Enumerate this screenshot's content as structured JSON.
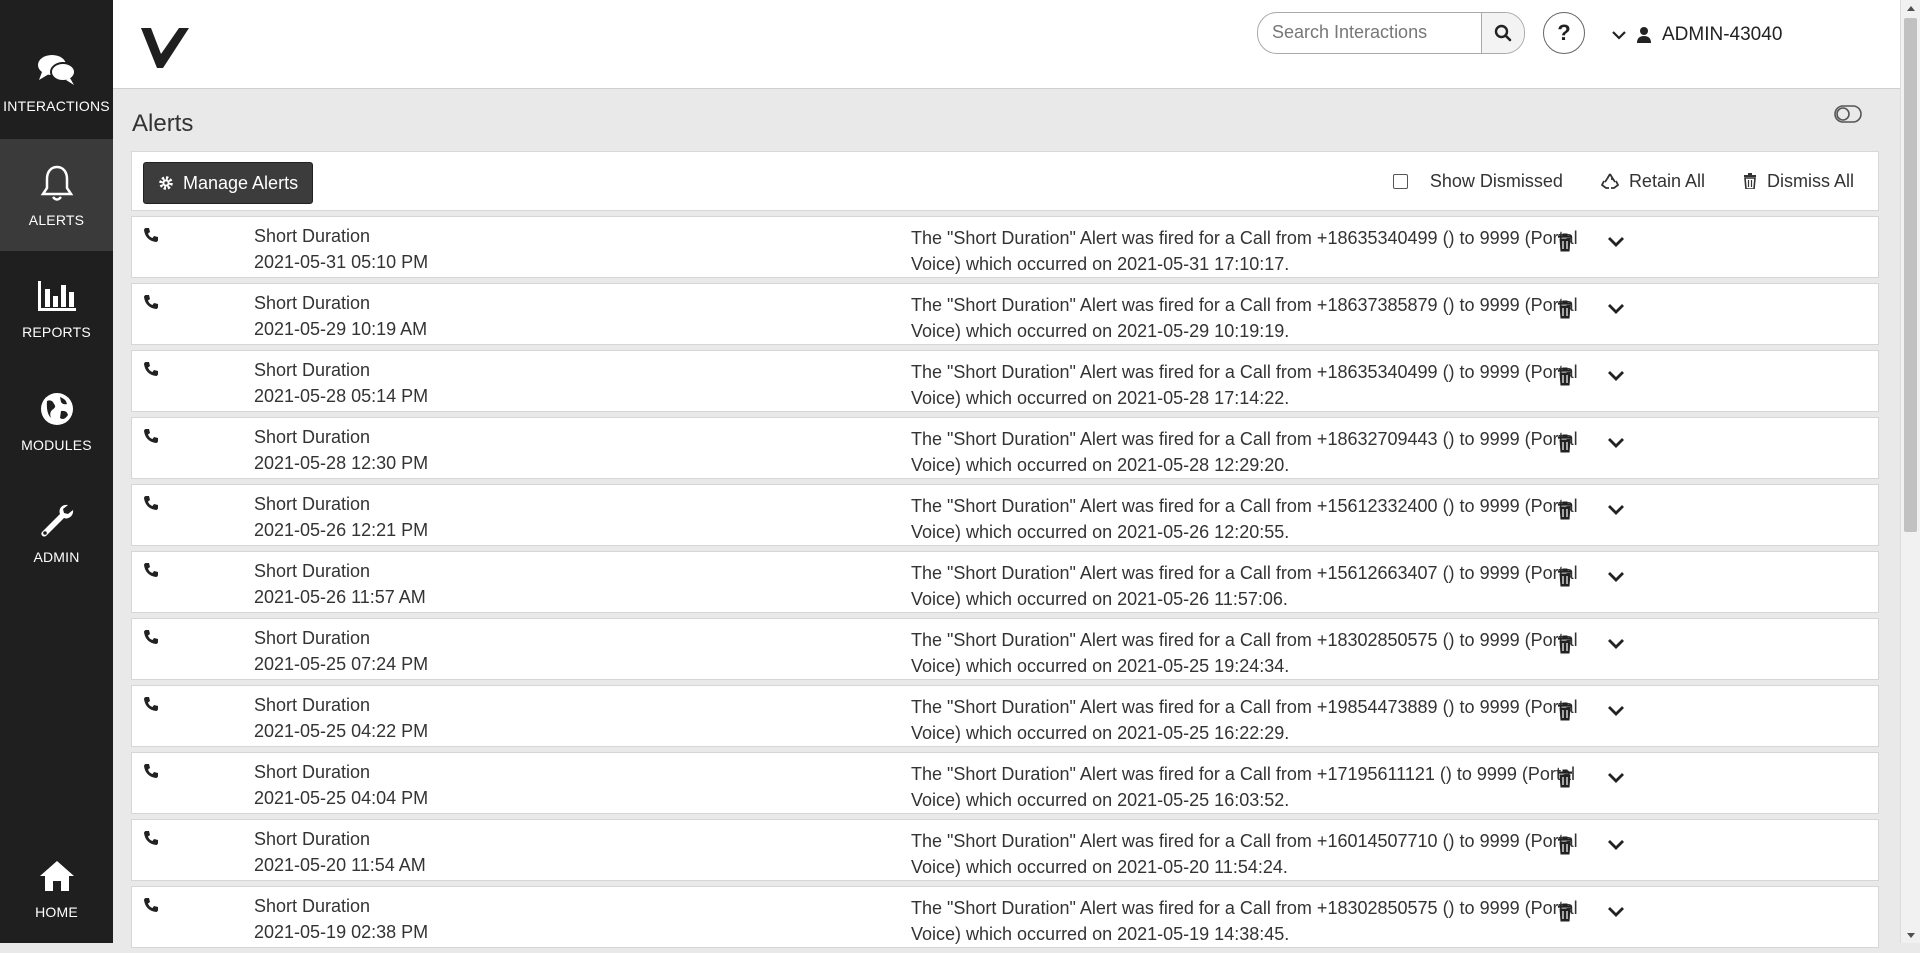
{
  "sidebar": {
    "items": [
      {
        "label": "INTERACTIONS",
        "icon": "chat-bubbles-icon"
      },
      {
        "label": "ALERTS",
        "icon": "bell-icon"
      },
      {
        "label": "REPORTS",
        "icon": "bar-chart-icon"
      },
      {
        "label": "MODULES",
        "icon": "globe-icon"
      },
      {
        "label": "ADMIN",
        "icon": "wrench-icon"
      },
      {
        "label": "HOME",
        "icon": "home-icon"
      }
    ]
  },
  "header": {
    "search_placeholder": "Search Interactions",
    "help_label": "?",
    "username": "ADMIN-43040"
  },
  "page": {
    "title": "Alerts"
  },
  "toolbar": {
    "manage_label": "Manage Alerts",
    "show_dismissed_label": "Show Dismissed",
    "retain_all_label": "Retain All",
    "dismiss_all_label": "Dismiss All"
  },
  "alerts": [
    {
      "name": "Short Duration",
      "date": "2021-05-31 05:10 PM",
      "desc": "The \"Short Duration\" Alert was fired for a Call from +18635340499 () to 9999 (Portal Voice) which occurred on 2021-05-31 17:10:17."
    },
    {
      "name": "Short Duration",
      "date": "2021-05-29 10:19 AM",
      "desc": "The \"Short Duration\" Alert was fired for a Call from +18637385879 () to 9999 (Portal Voice) which occurred on 2021-05-29 10:19:19."
    },
    {
      "name": "Short Duration",
      "date": "2021-05-28 05:14 PM",
      "desc": "The \"Short Duration\" Alert was fired for a Call from +18635340499 () to 9999 (Portal Voice) which occurred on 2021-05-28 17:14:22."
    },
    {
      "name": "Short Duration",
      "date": "2021-05-28 12:30 PM",
      "desc": "The \"Short Duration\" Alert was fired for a Call from +18632709443 () to 9999 (Portal Voice) which occurred on 2021-05-28 12:29:20."
    },
    {
      "name": "Short Duration",
      "date": "2021-05-26 12:21 PM",
      "desc": "The \"Short Duration\" Alert was fired for a Call from +15612332400 () to 9999 (Portal Voice) which occurred on 2021-05-26 12:20:55."
    },
    {
      "name": "Short Duration",
      "date": "2021-05-26 11:57 AM",
      "desc": "The \"Short Duration\" Alert was fired for a Call from +15612663407 () to 9999 (Portal Voice) which occurred on 2021-05-26 11:57:06."
    },
    {
      "name": "Short Duration",
      "date": "2021-05-25 07:24 PM",
      "desc": "The \"Short Duration\" Alert was fired for a Call from +18302850575 () to 9999 (Portal Voice) which occurred on 2021-05-25 19:24:34."
    },
    {
      "name": "Short Duration",
      "date": "2021-05-25 04:22 PM",
      "desc": "The \"Short Duration\" Alert was fired for a Call from +19854473889 () to 9999 (Portal Voice) which occurred on 2021-05-25 16:22:29."
    },
    {
      "name": "Short Duration",
      "date": "2021-05-25 04:04 PM",
      "desc": "The \"Short Duration\" Alert was fired for a Call from +17195611121 () to 9999 (Portal Voice) which occurred on 2021-05-25 16:03:52."
    },
    {
      "name": "Short Duration",
      "date": "2021-05-20 11:54 AM",
      "desc": "The \"Short Duration\" Alert was fired for a Call from +16014507710 () to 9999 (Portal Voice) which occurred on 2021-05-20 11:54:24."
    },
    {
      "name": "Short Duration",
      "date": "2021-05-19 02:38 PM",
      "desc": "The \"Short Duration\" Alert was fired for a Call from +18302850575 () to 9999 (Portal Voice) which occurred on 2021-05-19 14:38:45."
    }
  ]
}
